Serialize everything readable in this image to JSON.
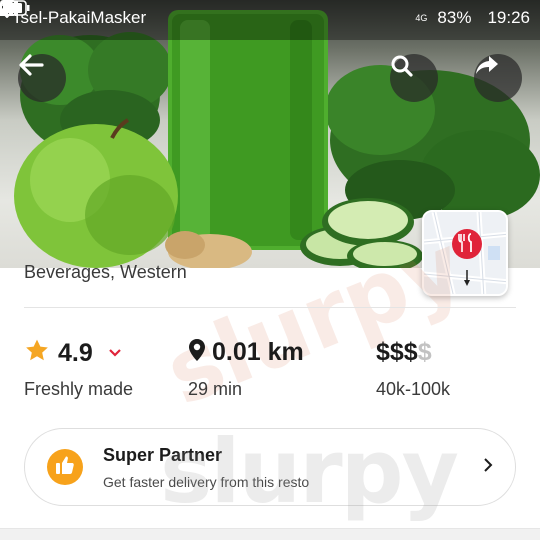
{
  "status_bar": {
    "carrier": "Tsel-PakaiMasker",
    "network": "4G",
    "battery": "83%",
    "time": "19:26",
    "icons": [
      "incognito-icon",
      "location-icon",
      "nfc-icon",
      "signal-icon",
      "battery-icon"
    ]
  },
  "header": {
    "buttons": [
      "back-icon",
      "search-icon",
      "share-icon"
    ]
  },
  "restaurant": {
    "categories": "Beverages, Western"
  },
  "stats": {
    "rating": "4.9",
    "rating_note": "Freshly made",
    "distance": "0.01 km",
    "delivery_time": "29 min",
    "price_active": "$$$",
    "price_inactive": "$",
    "price_range": "40k-100k",
    "accent_star": "#f5a623",
    "accent_chevron": "#e0243a"
  },
  "partner": {
    "title": "Super Partner",
    "subtitle": "Get faster delivery from this resto",
    "badge_color": "#f7a21b",
    "icon": "thumbs-up-icon"
  },
  "watermark": {
    "text": "slurpy"
  }
}
